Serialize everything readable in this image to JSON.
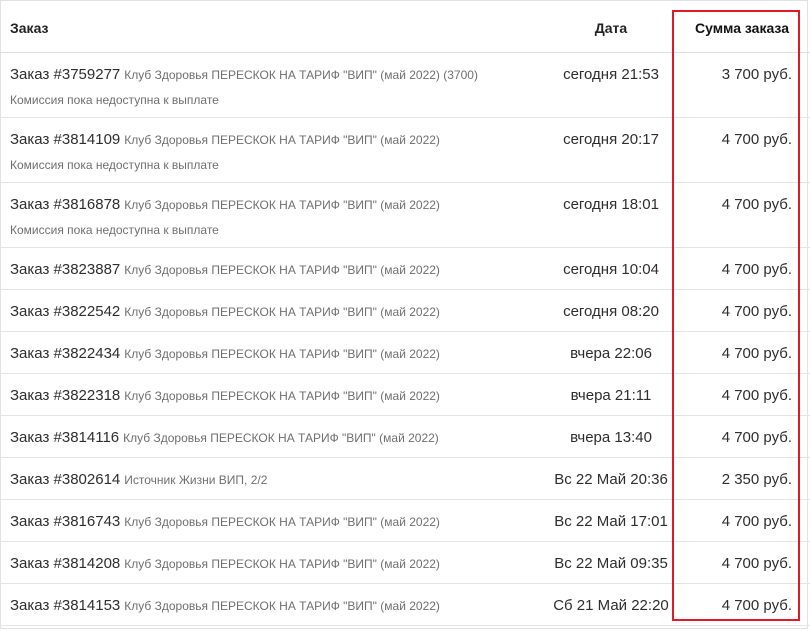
{
  "header": {
    "order": "Заказ",
    "date": "Дата",
    "sum": "Сумма заказа"
  },
  "highlight_color": "#e0192a",
  "rows": [
    {
      "order_id": "Заказ #3759277",
      "desc": "Клуб Здоровья ПЕРЕСКОК НА ТАРИФ \"ВИП\" (май 2022) (3700)",
      "note": "Комиссия пока недоступна к выплате",
      "date": "сегодня 21:53",
      "sum": "3 700 руб."
    },
    {
      "order_id": "Заказ #3814109",
      "desc": "Клуб Здоровья ПЕРЕСКОК НА ТАРИФ \"ВИП\" (май 2022)",
      "note": "Комиссия пока недоступна к выплате",
      "date": "сегодня 20:17",
      "sum": "4 700 руб."
    },
    {
      "order_id": "Заказ #3816878",
      "desc": "Клуб Здоровья ПЕРЕСКОК НА ТАРИФ \"ВИП\" (май 2022)",
      "note": "Комиссия пока недоступна к выплате",
      "date": "сегодня 18:01",
      "sum": "4 700 руб."
    },
    {
      "order_id": "Заказ #3823887",
      "desc": "Клуб Здоровья ПЕРЕСКОК НА ТАРИФ \"ВИП\" (май 2022)",
      "note": "",
      "date": "сегодня 10:04",
      "sum": "4 700 руб."
    },
    {
      "order_id": "Заказ #3822542",
      "desc": "Клуб Здоровья ПЕРЕСКОК НА ТАРИФ \"ВИП\" (май 2022)",
      "note": "",
      "date": "сегодня 08:20",
      "sum": "4 700 руб."
    },
    {
      "order_id": "Заказ #3822434",
      "desc": "Клуб Здоровья ПЕРЕСКОК НА ТАРИФ \"ВИП\" (май 2022)",
      "note": "",
      "date": "вчера 22:06",
      "sum": "4 700 руб."
    },
    {
      "order_id": "Заказ #3822318",
      "desc": "Клуб Здоровья ПЕРЕСКОК НА ТАРИФ \"ВИП\" (май 2022)",
      "note": "",
      "date": "вчера 21:11",
      "sum": "4 700 руб."
    },
    {
      "order_id": "Заказ #3814116",
      "desc": "Клуб Здоровья ПЕРЕСКОК НА ТАРИФ \"ВИП\" (май 2022)",
      "note": "",
      "date": "вчера 13:40",
      "sum": "4 700 руб."
    },
    {
      "order_id": "Заказ #3802614",
      "desc": "Источник Жизни ВИП, 2/2",
      "note": "",
      "date": "Вс 22 Май 20:36",
      "sum": "2 350 руб."
    },
    {
      "order_id": "Заказ #3816743",
      "desc": "Клуб Здоровья ПЕРЕСКОК НА ТАРИФ \"ВИП\" (май 2022)",
      "note": "",
      "date": "Вс 22 Май 17:01",
      "sum": "4 700 руб."
    },
    {
      "order_id": "Заказ #3814208",
      "desc": "Клуб Здоровья ПЕРЕСКОК НА ТАРИФ \"ВИП\" (май 2022)",
      "note": "",
      "date": "Вс 22 Май 09:35",
      "sum": "4 700 руб."
    },
    {
      "order_id": "Заказ #3814153",
      "desc": "Клуб Здоровья ПЕРЕСКОК НА ТАРИФ \"ВИП\" (май 2022)",
      "note": "",
      "date": "Сб 21 Май 22:20",
      "sum": "4 700 руб."
    }
  ]
}
